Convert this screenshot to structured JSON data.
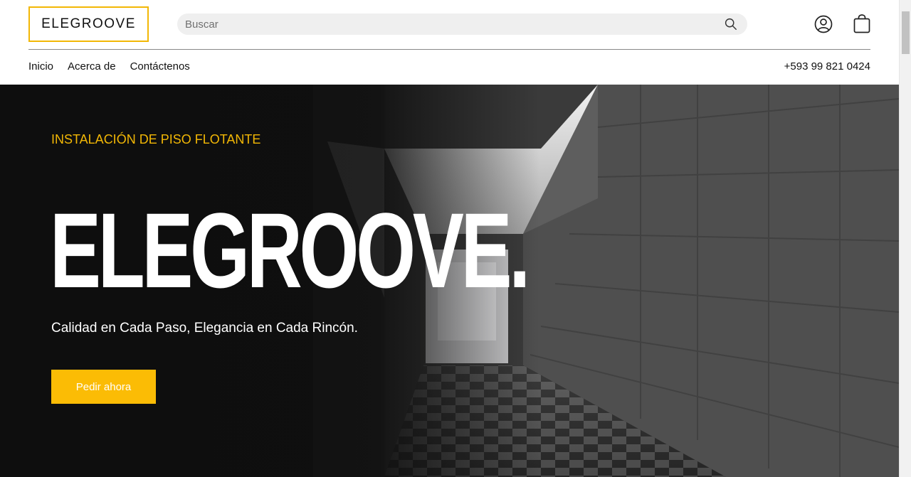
{
  "header": {
    "logo": "ELEGROOVE",
    "search_placeholder": "Buscar",
    "nav": [
      "Inicio",
      "Acerca de",
      "Contáctenos"
    ],
    "phone": "+593 99 821 0424"
  },
  "hero": {
    "subtitle": "INSTALACIÓN DE PISO FLOTANTE",
    "title": "ELEGROOVE.",
    "tagline": "Calidad en Cada Paso, Elegancia en Cada Rincón.",
    "cta": "Pedir ahora"
  },
  "colors": {
    "accent": "#f2b705",
    "button": "#fbbc05",
    "hero_bg": "#141414"
  },
  "icons": [
    "search-icon",
    "account-icon",
    "cart-icon"
  ]
}
